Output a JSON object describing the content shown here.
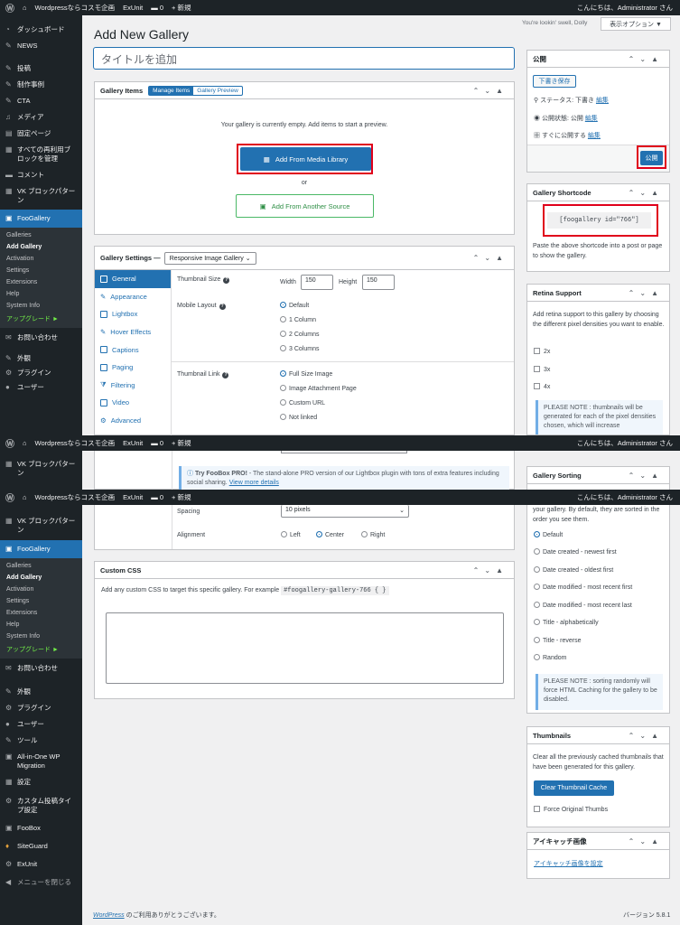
{
  "adminbar": {
    "site": "Wordpressならコスモ企画",
    "exunit": "ExUnit",
    "comments": "0",
    "new": "新規",
    "greeting": "こんにちは、Administrator さん"
  },
  "header": {
    "dolly": "You're lookin' swell, Dolly",
    "screen_options": "表示オプション ▼",
    "page_title": "Add New Gallery",
    "title_placeholder": "タイトルを追加"
  },
  "sidebar": {
    "items_top": [
      "ダッシュボード",
      "NEWS",
      "投稿",
      "制作事例",
      "CTA",
      "メディア",
      "固定ページ",
      "すべての再利用ブロックを管理",
      "コメント",
      "VK ブロックパターン",
      "FooGallery"
    ],
    "submenu": [
      "Galleries",
      "Add Gallery",
      "Activation",
      "Settings",
      "Extensions",
      "Help",
      "System Info",
      "アップグレード ►"
    ],
    "items_bottom": [
      "お問い合わせ",
      "外観",
      "プラグイン",
      "ユーザー",
      "ツール",
      "All-in-One WP Migration",
      "設定",
      "カスタム投稿タイプ設定",
      "FooBox",
      "SiteGuard",
      "ExUnit",
      "メニューを閉じる"
    ]
  },
  "gallery_items": {
    "title": "Gallery Items",
    "tab_manage": "Manage Items",
    "tab_preview": "Gallery Preview",
    "empty": "Your gallery is currently empty. Add items to start a preview.",
    "add_media": "Add From Media Library",
    "or": "or",
    "add_other": "Add From Another Source"
  },
  "gallery_settings": {
    "title": "Gallery Settings —",
    "template": "Responsive Image Gallery ⌄",
    "tabs": [
      "General",
      "Appearance",
      "Lightbox",
      "Hover Effects",
      "Captions",
      "Paging",
      "Filtering",
      "Video",
      "Advanced"
    ],
    "thumb_size": "Thumbnail Size",
    "width_label": "Width",
    "width": "150",
    "height_label": "Height",
    "height": "150",
    "mobile_layout": "Mobile Layout",
    "mobile_opts": [
      "Default",
      "1 Column",
      "2 Columns",
      "3 Columns"
    ],
    "thumb_link": "Thumbnail Link",
    "link_opts": [
      "Full Size Image",
      "Image Attachment Page",
      "Custom URL",
      "Not linked"
    ],
    "foobox_bold": "Try FooBox PRO!",
    "foobox_text": " - The stand-alone PRO version of our Lightbox plugin with tons of extra features including social sharing. ",
    "foobox_link": "View more details",
    "spacing": "Spacing",
    "spacing_val": "10 pixels",
    "alignment": "Alignment",
    "align_opts": [
      "Left",
      "Center",
      "Right"
    ]
  },
  "custom_css": {
    "title": "Custom CSS",
    "desc": "Add any custom CSS to target this specific gallery. For example",
    "code": "#foogallery-gallery-766 { }"
  },
  "publish": {
    "title": "公開",
    "draft": "下書き保存",
    "status": "ステータス: 下書き",
    "status_edit": "編集",
    "visibility": "公開状態: 公開",
    "visibility_edit": "編集",
    "schedule": "すぐに公開する",
    "schedule_edit": "編集",
    "publish_btn": "公開"
  },
  "shortcode": {
    "title": "Gallery Shortcode",
    "code": "[foogallery id=\"766\"]",
    "desc": "Paste the above shortcode into a post or page to show the gallery."
  },
  "retina": {
    "title": "Retina Support",
    "desc": "Add retina support to this gallery by choosing the different pixel densities you want to enable.",
    "opts": [
      "2x",
      "3x",
      "4x"
    ],
    "note": "PLEASE NOTE : thumbnails will be generated for each of the pixel densities chosen, which will increase"
  },
  "sorting": {
    "title": "Gallery Sorting",
    "desc_partial": "your gallery. By default, they are sorted in the order you see them.",
    "opts": [
      "Default",
      "Date created - newest first",
      "Date created - oldest first",
      "Date modified - most recent first",
      "Date modified - most recent last",
      "Title - alphabetically",
      "Title - reverse",
      "Random"
    ],
    "note": "PLEASE NOTE : sorting randomly will force HTML Caching for the gallery to be disabled."
  },
  "thumbnails": {
    "title": "Thumbnails",
    "desc": "Clear all the previously cached thumbnails that have been generated for this gallery.",
    "btn": "Clear Thumbnail Cache",
    "force": "Force Original Thumbs"
  },
  "eyecatch": {
    "title": "アイキャッチ画像",
    "link": "アイキャッチ画像を設定"
  },
  "footer": {
    "wp": "WordPress",
    "thanks": " のご利用ありがとうございます。",
    "version": "バージョン 5.8.1"
  },
  "colors": {
    "accent": "#2271b1",
    "highlight": "#e0001b",
    "adminbar": "#1d2327"
  }
}
